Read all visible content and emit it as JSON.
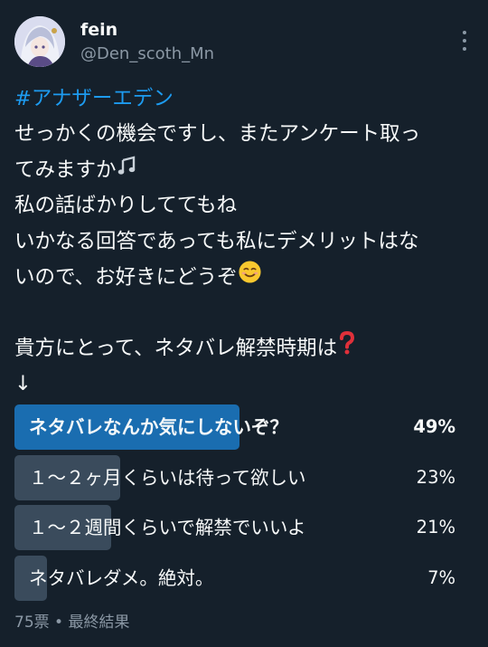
{
  "user": {
    "display_name": "fein",
    "handle": "@Den_scoth_Mn"
  },
  "tweet": {
    "hashtag": "#アナザーエデン",
    "lines": [
      "せっかくの機会ですし、またアンケート取っ",
      "てみますか",
      "私の話ばかりしててもね",
      "いかなる回答であっても私にデメリットはな",
      "いので、お好きにどうぞ",
      "",
      "貴方にとって、ネタバレ解禁時期は",
      "↓"
    ]
  },
  "poll": {
    "options": [
      {
        "label": "ネタバレなんか気にしないぞ？",
        "percent_label": "49%",
        "percent": 49,
        "winner": true
      },
      {
        "label": "１～２ヶ月くらいは待って欲しい",
        "percent_label": "23%",
        "percent": 23,
        "winner": false
      },
      {
        "label": "１～２週間くらいで解禁でいいよ",
        "percent_label": "21%",
        "percent": 21,
        "winner": false
      },
      {
        "label": "ネタバレダメ。絶対。",
        "percent_label": "7%",
        "percent": 7,
        "winner": false
      }
    ],
    "footer": "75票 • 最終結果"
  },
  "icons": {
    "more": "more-vertical-icon",
    "note": "musical-notes-emoji",
    "smile": "smiling-face-emoji",
    "question": "red-question-mark-emoji"
  },
  "colors": {
    "background": "#15202b",
    "link": "#1d9bf0",
    "winner_bar": "#1a6db0",
    "bar": "#3a4b5c",
    "secondary_text": "#8b98a5"
  }
}
